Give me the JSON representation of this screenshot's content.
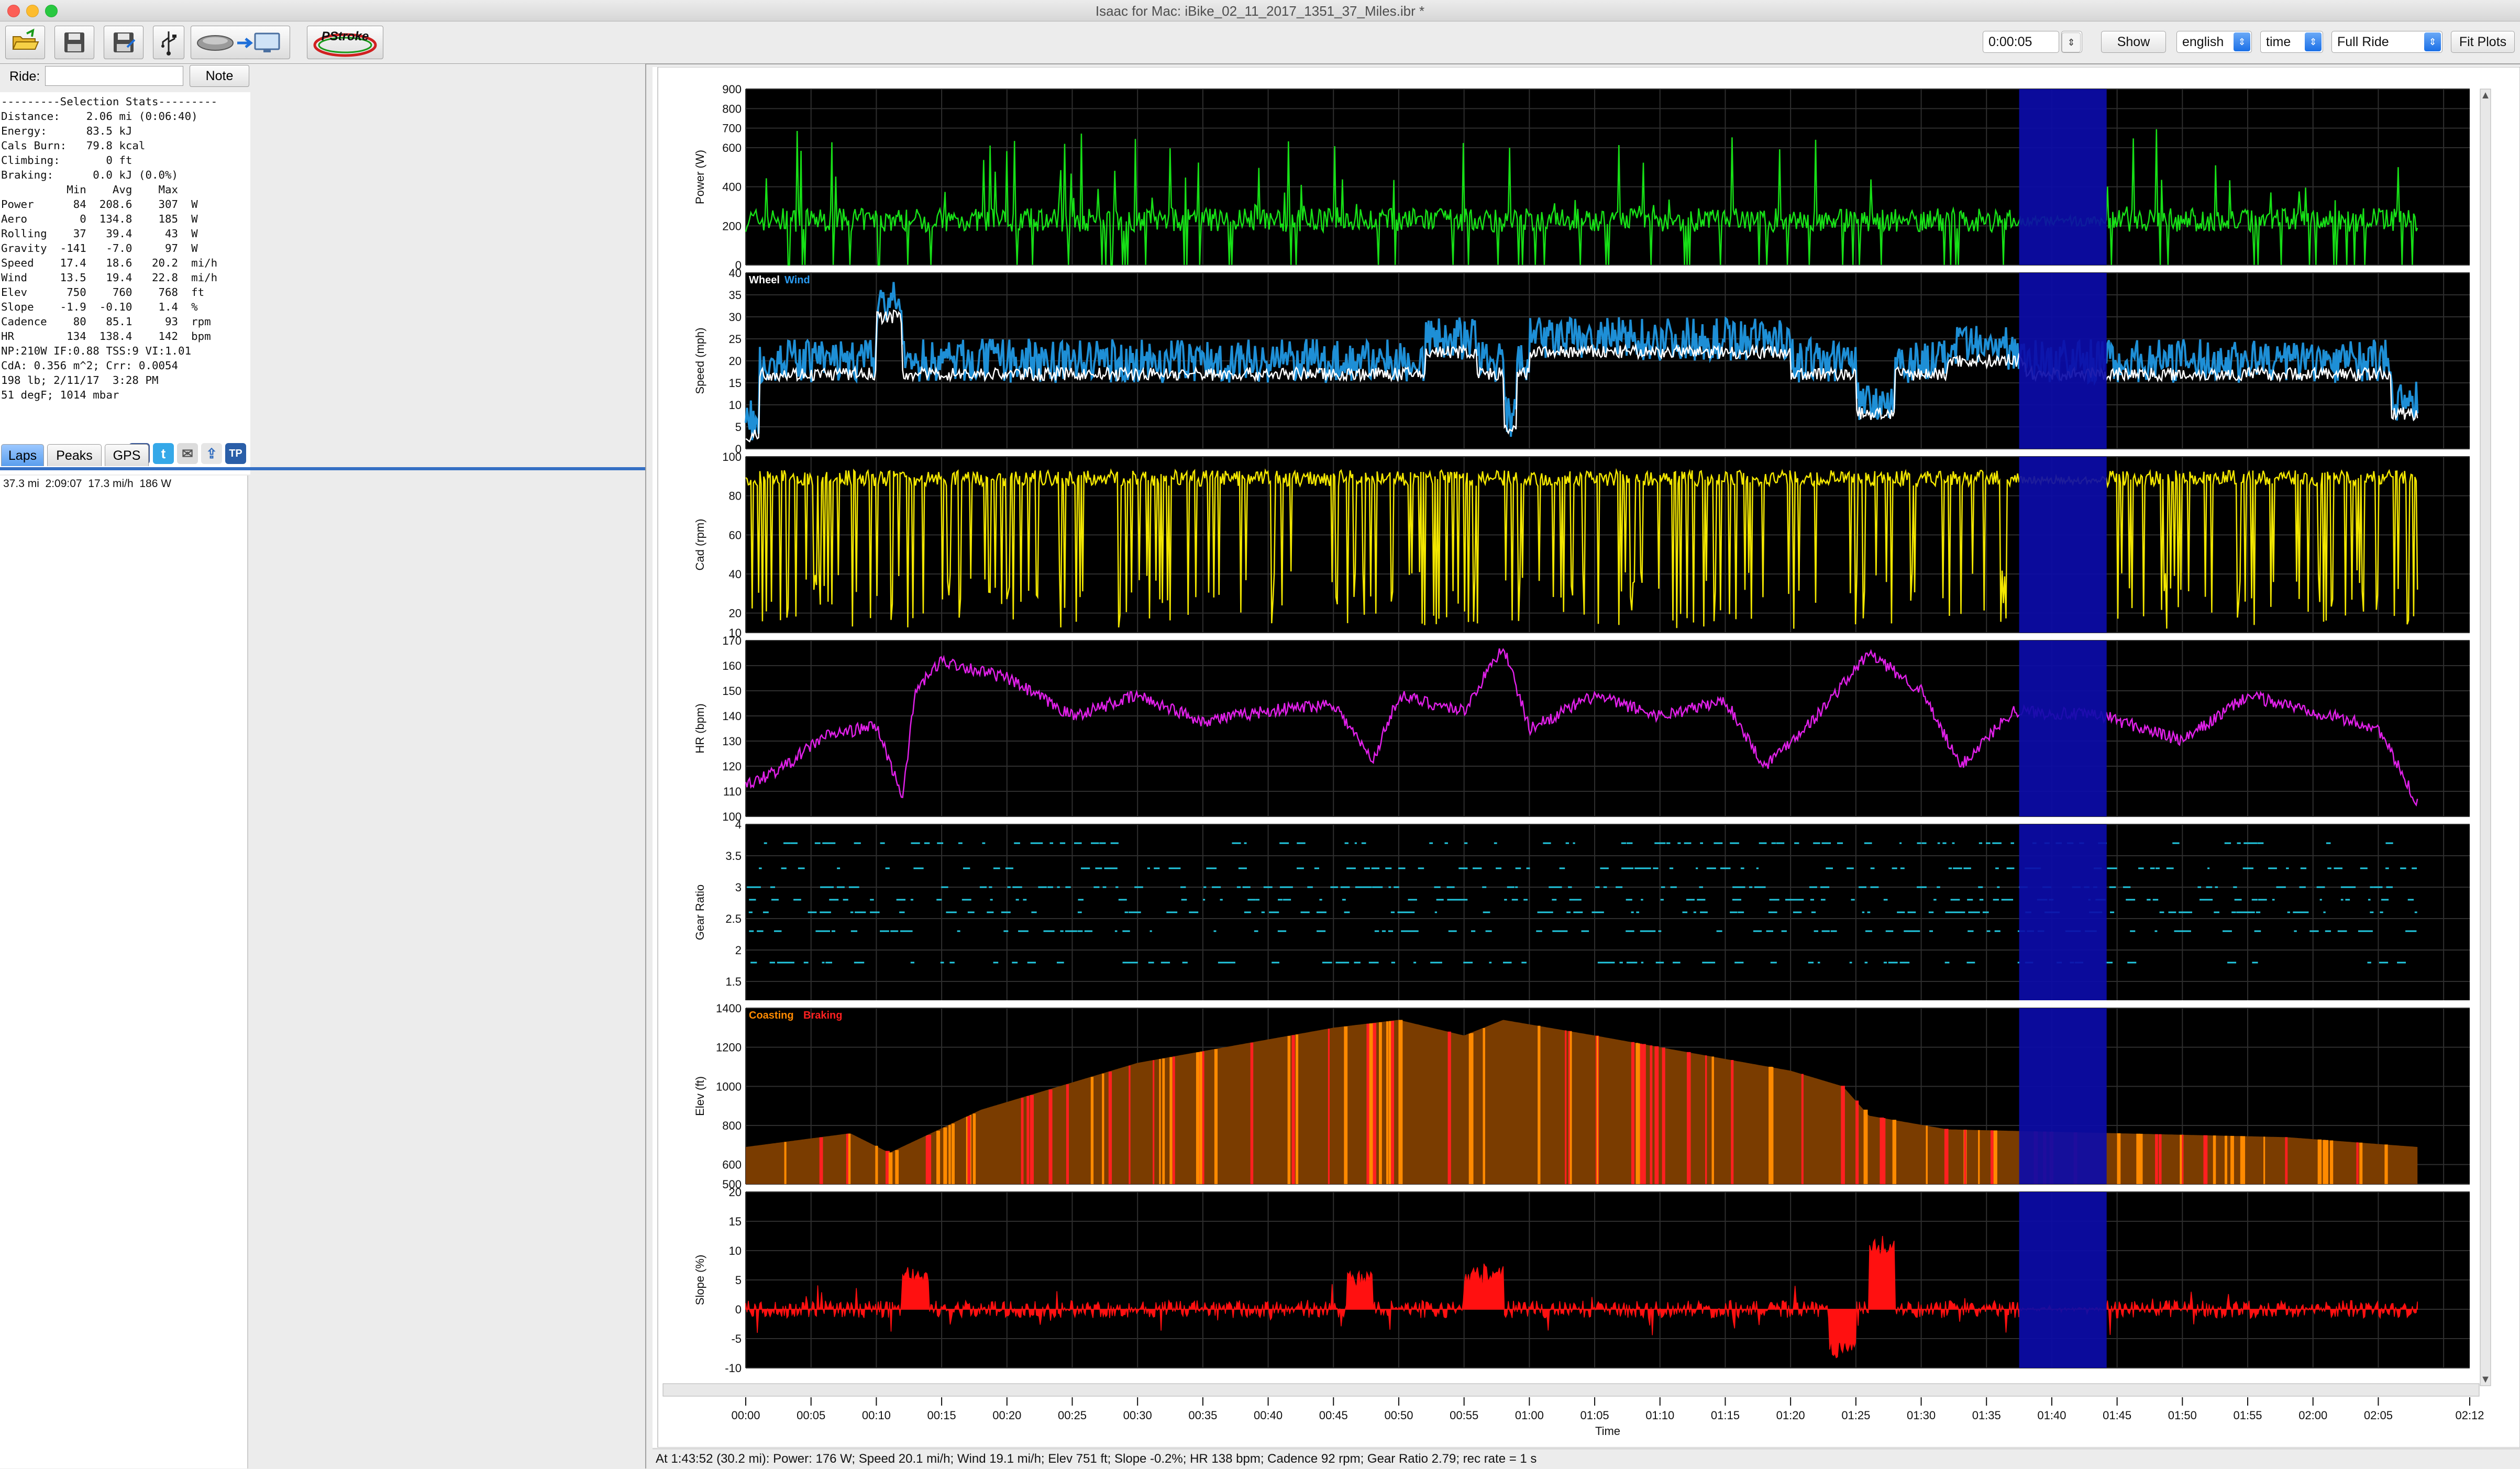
{
  "window": {
    "title": "Isaac for Mac:  iBike_02_11_2017_1351_37_Miles.ibr *"
  },
  "toolbar": {
    "icons": [
      "open-folder-icon",
      "save-icon",
      "save-as-icon",
      "usb-icon",
      "device-transfer-icon"
    ],
    "pstroke_label": "PStroke",
    "time_value": "0:00:05",
    "show_label": "Show",
    "units_value": "english",
    "axis_value": "time",
    "range_value": "Full Ride",
    "fit_label": "Fit Plots"
  },
  "ride": {
    "label": "Ride:",
    "name_value": "",
    "note_label": "Note"
  },
  "stats": {
    "header": "---------Selection Stats---------",
    "summary": [
      "Distance:    2.06 mi (0:06:40)",
      "Energy:      83.5 kJ",
      "Cals Burn:   79.8 kcal",
      "Climbing:       0 ft",
      "Braking:      0.0 kJ (0.0%)"
    ],
    "table_header": "          Min    Avg    Max",
    "rows": [
      "Power      84  208.6    307  W",
      "Aero        0  134.8    185  W",
      "Rolling    37   39.4     43  W",
      "Gravity  -141   -7.0     97  W",
      "Speed    17.4   18.6   20.2  mi/h",
      "Wind     13.5   19.4   22.8  mi/h",
      "Elev      750    760    768  ft",
      "Slope    -1.9  -0.10    1.4  %",
      "Cadence    80   85.1     93  rpm",
      "HR        134  138.4    142  bpm"
    ],
    "footer": [
      "NP:210W IF:0.88 TSS:9 VI:1.01",
      "CdA: 0.356 m^2; Crr: 0.0054",
      "198 lb; 2/11/17  3:28 PM",
      "51 degF; 1014 mbar"
    ],
    "share_icons": [
      "facebook-icon",
      "twitter-icon",
      "email-icon",
      "upload-icon",
      "trainingpeaks-icon"
    ]
  },
  "tabs": [
    {
      "label": "Laps"
    },
    {
      "label": "Peaks"
    },
    {
      "label": "GPS"
    }
  ],
  "laps": [
    {
      "distance": "37.3 mi",
      "time": "2:09:07",
      "speed": "17.3 mi/h",
      "power": "186 W"
    }
  ],
  "charts": {
    "time_axis": {
      "label": "Time",
      "ticks": [
        "00:00",
        "00:05",
        "00:10",
        "00:15",
        "00:20",
        "00:25",
        "00:30",
        "00:35",
        "00:40",
        "00:45",
        "00:50",
        "00:55",
        "01:00",
        "01:05",
        "01:10",
        "01:15",
        "01:20",
        "01:25",
        "01:30",
        "01:35",
        "01:40",
        "01:45",
        "01:50",
        "01:55",
        "02:00",
        "02:05",
        "02:12"
      ]
    },
    "selection": {
      "start_min": 97.5,
      "end_min": 104.2,
      "color": "#0c0ca8"
    },
    "panels": [
      {
        "key": "power",
        "ylabel": "Power (W)",
        "ymin": 0,
        "ymax": 900,
        "ticks": [
          0,
          200,
          400,
          600,
          700,
          800,
          900
        ],
        "color": "#17e017",
        "style": "line"
      },
      {
        "key": "speed",
        "ylabel": "Speed (mph)",
        "ymin": 0,
        "ymax": 40,
        "ticks": [
          0,
          5,
          10,
          15,
          20,
          25,
          30,
          35,
          40
        ],
        "color": "#ffffff",
        "color2": "#1e8fd6",
        "style": "speed",
        "legend": [
          {
            "text": "Wheel",
            "color": "#ffffff"
          },
          {
            "text": "Wind",
            "color": "#2a9af0"
          }
        ]
      },
      {
        "key": "cadence",
        "ylabel": "Cad (rpm)",
        "ymin": 10,
        "ymax": 100,
        "ticks": [
          10,
          20,
          40,
          60,
          80,
          100
        ],
        "color": "#f2e600",
        "style": "line"
      },
      {
        "key": "hr",
        "ylabel": "HR (bpm)",
        "ymin": 100,
        "ymax": 170,
        "ticks": [
          100,
          110,
          120,
          130,
          140,
          150,
          160,
          170
        ],
        "color": "#e020e8",
        "style": "line"
      },
      {
        "key": "gear",
        "ylabel": "Gear Ratio",
        "ymin": 1.2,
        "ymax": 4,
        "ticks": [
          1.5,
          2,
          2.5,
          3,
          3.5,
          4
        ],
        "color": "#22c8e0",
        "style": "dots"
      },
      {
        "key": "elev",
        "ylabel": "Elev (ft)",
        "ymin": 500,
        "ymax": 1400,
        "ticks": [
          500,
          600,
          800,
          1000,
          1200,
          1400
        ],
        "color": "#7a3c00",
        "style": "area",
        "legend": [
          {
            "text": "Coasting",
            "color": "#ff8a00"
          },
          {
            "text": "Braking",
            "color": "#ff2020"
          }
        ]
      },
      {
        "key": "slope",
        "ylabel": "Slope (%)",
        "ymin": -10,
        "ymax": 20,
        "ticks": [
          -10,
          -5,
          0,
          5,
          10,
          15,
          20
        ],
        "color": "#ff1010",
        "style": "fill0"
      }
    ]
  },
  "status": {
    "text": "At 1:43:52 (30.2 mi): Power: 176 W; Speed 20.1 mi/h; Wind 19.1 mi/h; Elev 751 ft; Slope -0.2%; HR 138 bpm; Cadence 92 rpm; Gear Ratio 2.79; rec rate = 1 s"
  }
}
